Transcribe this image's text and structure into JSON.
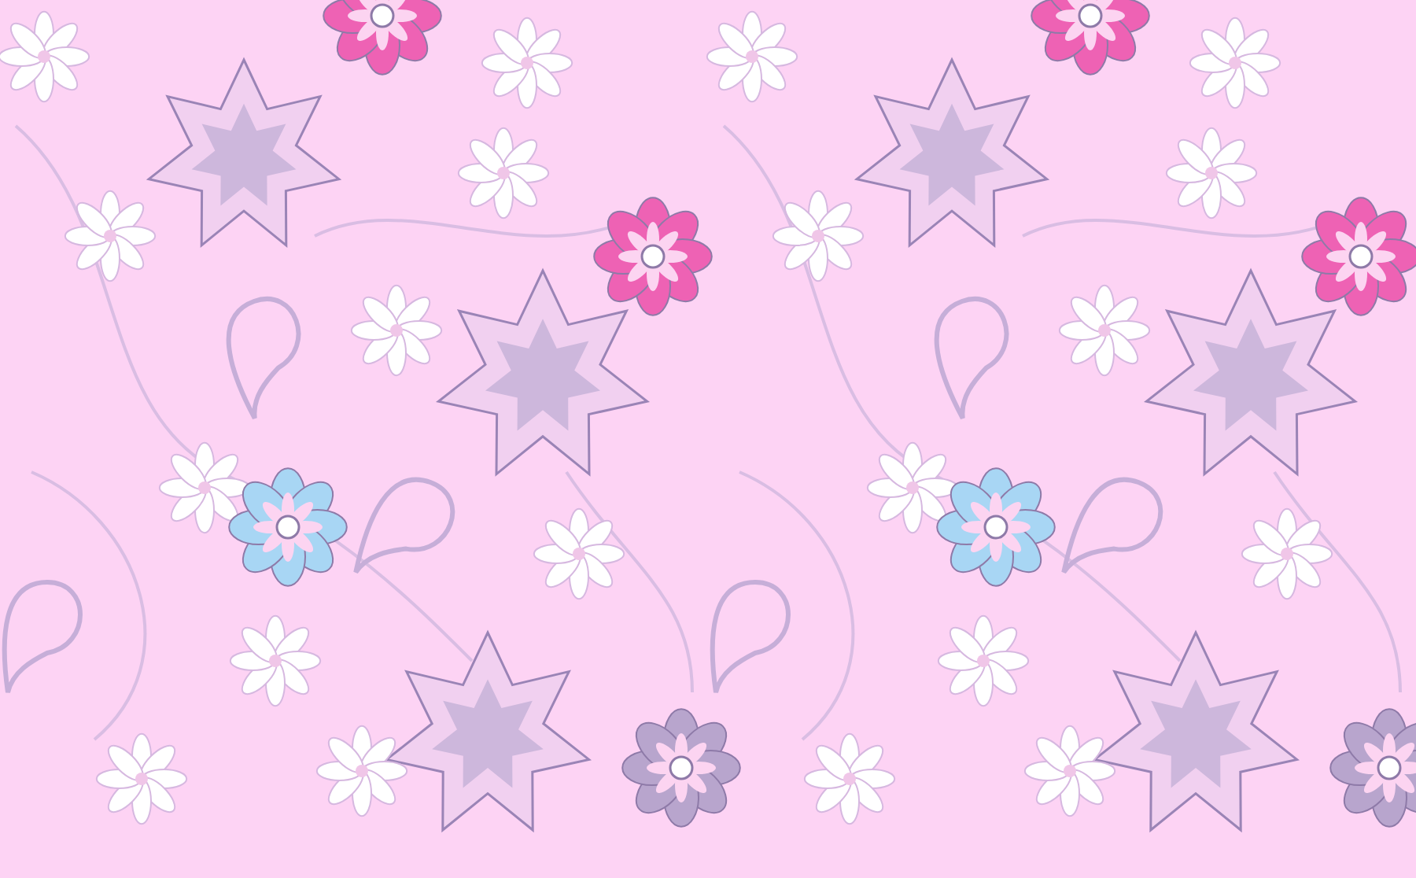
{
  "flowers": [
    {
      "color": "#ee62b4"
    },
    {
      "color": "#ee62b4"
    },
    {
      "color": "#a8d6f4"
    },
    {
      "color": "#b8a5cd"
    }
  ]
}
